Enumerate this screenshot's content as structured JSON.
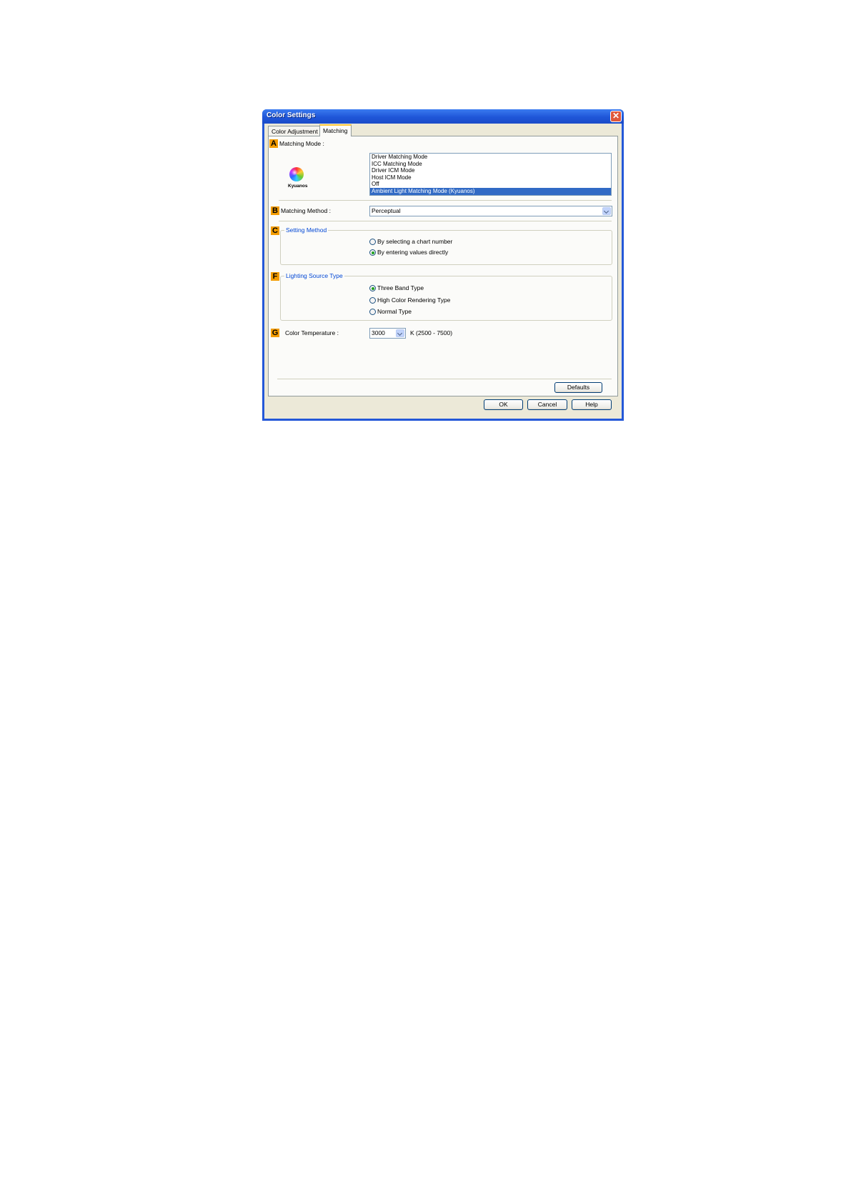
{
  "window": {
    "title": "Color Settings"
  },
  "tabs": [
    {
      "label": "Color Adjustment"
    },
    {
      "label": "Matching"
    }
  ],
  "matching_mode": {
    "badge": "A",
    "label": "Matching Mode :",
    "logo_text": "Kyuanos",
    "options": [
      "Driver Matching Mode",
      "ICC Matching Mode",
      "Driver ICM Mode",
      "Host ICM Mode",
      "Off",
      "Ambient Light Matching Mode (Kyuanos)"
    ],
    "selected": "Ambient Light Matching Mode (Kyuanos)"
  },
  "matching_method": {
    "badge": "B",
    "label": "Matching Method :",
    "value": "Perceptual"
  },
  "setting_method": {
    "badge": "C",
    "title": "Setting Method",
    "options": [
      "By selecting a chart number",
      "By entering values directly"
    ],
    "selected": "By entering values directly"
  },
  "lighting_source": {
    "badge": "F",
    "title": "Lighting Source Type",
    "options": [
      "Three Band Type",
      "High Color Rendering Type",
      "Normal Type"
    ],
    "selected": "Three Band Type"
  },
  "color_temperature": {
    "badge": "G",
    "label": "Color Temperature :",
    "value": "3000",
    "range": "K (2500 - 7500)"
  },
  "buttons": {
    "defaults": "Defaults",
    "ok": "OK",
    "cancel": "Cancel",
    "help": "Help"
  }
}
